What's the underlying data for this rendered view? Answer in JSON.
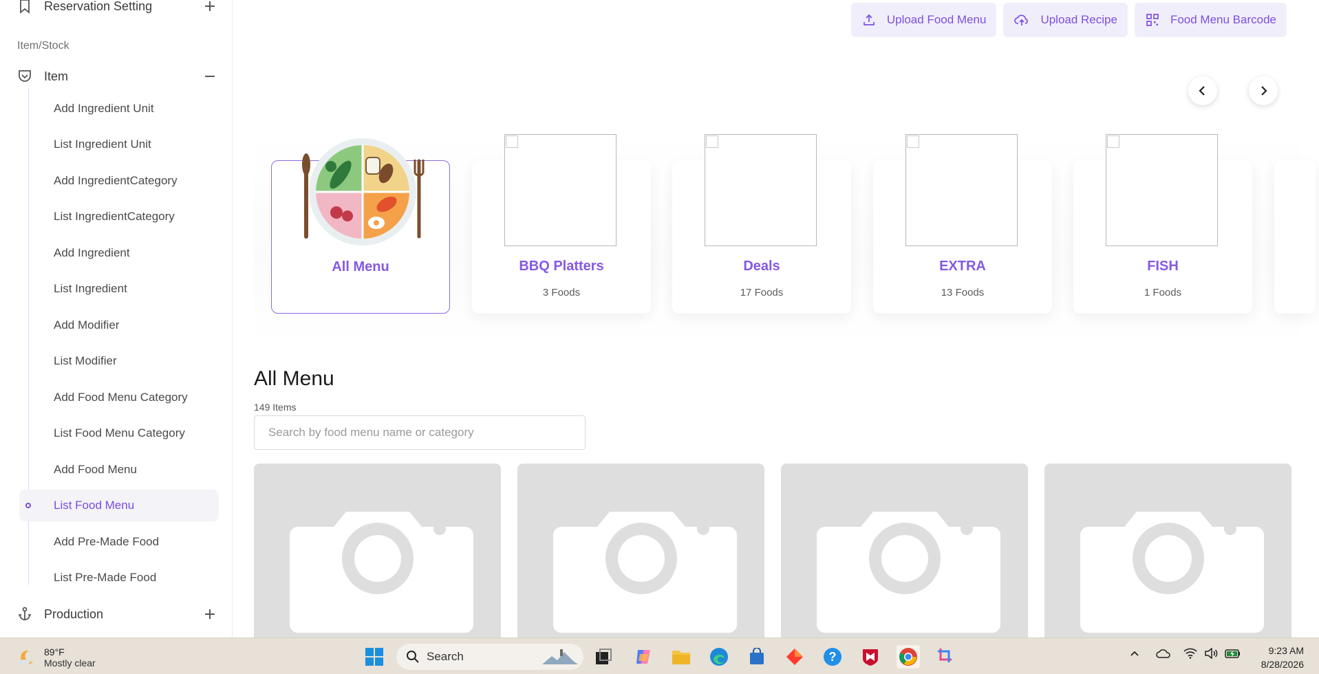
{
  "sidebar": {
    "top_item": "Reservation Setting",
    "section_label": "Item/Stock",
    "group_item": "Item",
    "sub_items": [
      "Add Ingredient Unit",
      "List Ingredient Unit",
      "Add IngredientCategory",
      "List IngredientCategory",
      "Add Ingredient",
      "List Ingredient",
      "Add Modifier",
      "List Modifier",
      "Add Food Menu Category",
      "List Food Menu Category",
      "Add Food Menu",
      "List Food Menu",
      "Add Pre-Made Food",
      "List Pre-Made Food"
    ],
    "active_sub_item": "List Food Menu",
    "bottom_item": "Production"
  },
  "toolbar": {
    "upload_food_menu": "Upload Food Menu",
    "upload_recipe": "Upload Recipe",
    "food_menu_barcode": "Food Menu Barcode"
  },
  "categories": [
    {
      "name": "All Menu",
      "count": "",
      "active": true
    },
    {
      "name": "BBQ Platters",
      "count": "3 Foods"
    },
    {
      "name": "Deals",
      "count": "17 Foods"
    },
    {
      "name": "EXTRA",
      "count": "13 Foods"
    },
    {
      "name": "FISH",
      "count": "1 Foods"
    }
  ],
  "listing": {
    "title": "All Menu",
    "count": "149 Items",
    "search_placeholder": "Search by food menu name or category"
  },
  "taskbar": {
    "temperature": "89°F",
    "weather": "Mostly clear",
    "search": "Search",
    "time": "9:23 AM",
    "date": "8/28/2026"
  },
  "colors": {
    "accent": "#8558e5",
    "button_bg": "#f1eefb",
    "placeholder_bg": "#dedede"
  }
}
